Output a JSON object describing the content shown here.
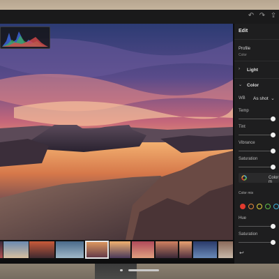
{
  "panel": {
    "title": "Edit",
    "profile_label": "Profile",
    "profile_value": "Color",
    "sections": {
      "light": "Light",
      "color": "Color"
    },
    "wb_label": "WB",
    "wb_value": "As shot",
    "sliders": [
      {
        "name": "temp",
        "label": "Temp",
        "level": 0.95
      },
      {
        "name": "tint",
        "label": "Tint",
        "level": 0.95
      },
      {
        "name": "vibrance",
        "label": "Vibrance",
        "level": 0.95
      },
      {
        "name": "saturation",
        "label": "Saturation",
        "level": 0.95
      }
    ],
    "color_mixer_button": "Color m",
    "color_mix_label": "Color mix",
    "mix_sliders": [
      {
        "name": "hue",
        "label": "Hue",
        "level": 0.95
      },
      {
        "name": "saturation",
        "label": "Saturation",
        "level": 0.95
      }
    ],
    "swatch_colors": [
      "#e23a2e",
      "#e8893a",
      "#e6d23a",
      "#5fbf4a",
      "#3fb0d8"
    ]
  },
  "colors": {
    "accent": "#e23a2e",
    "panel_bg": "#1e1e1f"
  },
  "filmstrip": {
    "count": 11,
    "selected_index": 4
  }
}
